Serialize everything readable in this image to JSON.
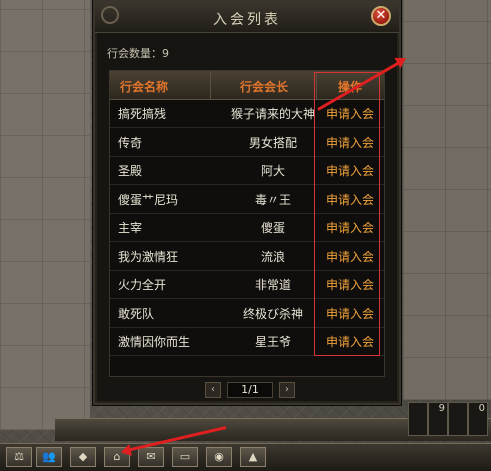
{
  "window": {
    "title": "入会列表",
    "close_glyph": "✕",
    "guild_count_label": "行会数量：9"
  },
  "table": {
    "headers": [
      "行会名称",
      "行会会长",
      "操作"
    ],
    "rows": [
      {
        "name": "搞死搞残",
        "leader": "猴子请来的大神",
        "action": "申请入会"
      },
      {
        "name": "传奇",
        "leader": "男女搭配",
        "action": "申请入会"
      },
      {
        "name": "圣殿",
        "leader": "阿大",
        "action": "申请入会"
      },
      {
        "name": "傻蛋艹尼玛",
        "leader": "毒〃王",
        "action": "申请入会"
      },
      {
        "name": "主宰",
        "leader": "傻蛋",
        "action": "申请入会"
      },
      {
        "name": "我为激情狂",
        "leader": "流浪",
        "action": "申请入会"
      },
      {
        "name": "火力全开",
        "leader": "非常道",
        "action": "申请入会"
      },
      {
        "name": "敢死队",
        "leader": "终极び杀神",
        "action": "申请入会"
      },
      {
        "name": "激情因你而生",
        "leader": "星王爷",
        "action": "申请入会"
      }
    ]
  },
  "pager": {
    "prev_glyph": "‹",
    "page_text": "1/1",
    "next_glyph": "›"
  },
  "slots": {
    "slot_a": "9",
    "slot_b": "0"
  },
  "toolbar": {
    "buttons": [
      {
        "icon": "scale-icon",
        "glyph": "⚖"
      },
      {
        "icon": "group-icon",
        "glyph": "👥"
      },
      {
        "icon": "handshake-icon",
        "glyph": "◆"
      },
      {
        "icon": "guild-icon",
        "glyph": "⌂"
      },
      {
        "icon": "mail-icon",
        "glyph": "✉"
      },
      {
        "icon": "monitor-icon",
        "glyph": "▭"
      },
      {
        "icon": "eye-icon",
        "glyph": "◉"
      },
      {
        "icon": "mountain-icon",
        "glyph": "▲"
      }
    ]
  },
  "colors": {
    "header_text": "#e2752c",
    "action_text": "#f0a23c",
    "annotation": "#e02020"
  }
}
